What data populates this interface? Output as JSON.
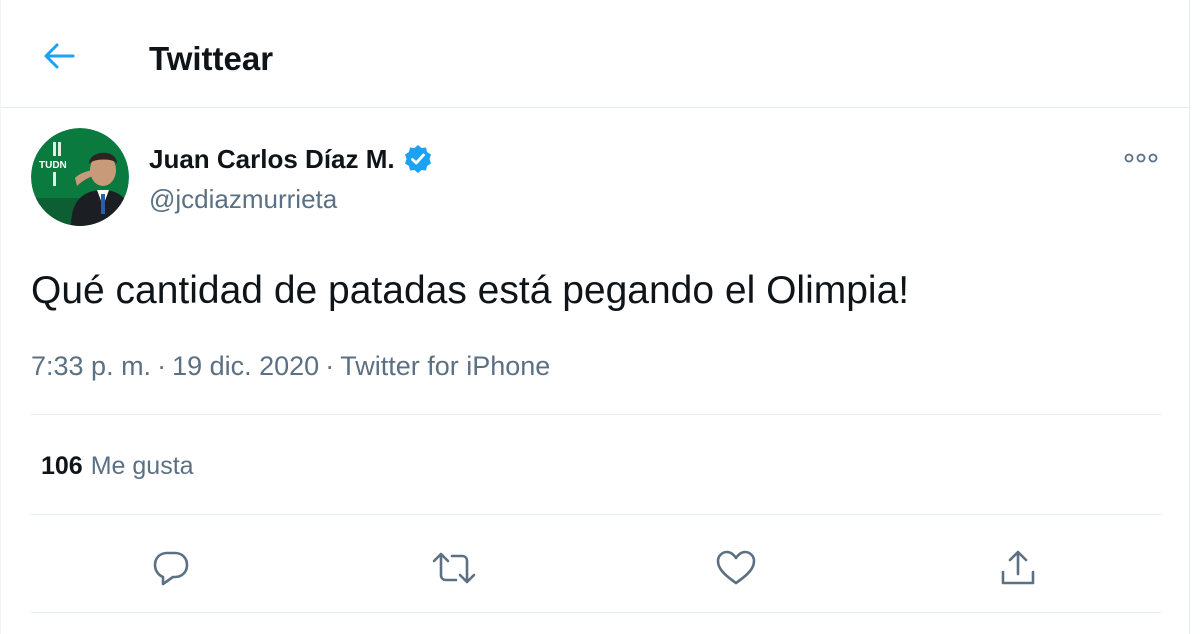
{
  "header": {
    "title": "Twittear",
    "back_icon": "arrow-left-icon"
  },
  "tweet": {
    "author": {
      "display_name": "Juan Carlos Díaz M.",
      "handle": "@jcdiazmurrieta",
      "verified": true,
      "avatar_text": "TUDN"
    },
    "text": "Qué cantidad de patadas está pegando el Olimpia!",
    "time": "7:33 p. m.",
    "separator": "·",
    "date": "19 dic. 2020",
    "source": "Twitter for iPhone",
    "likes": {
      "count": "106",
      "label": "Me gusta"
    }
  },
  "actions": [
    {
      "name": "reply",
      "icon": "reply-icon"
    },
    {
      "name": "retweet",
      "icon": "retweet-icon"
    },
    {
      "name": "like",
      "icon": "heart-icon"
    },
    {
      "name": "share",
      "icon": "share-icon"
    }
  ],
  "colors": {
    "accent": "#1da1f2",
    "text": "#0f1419",
    "muted": "#5b7083",
    "border": "#e6ecf0",
    "avatar_bg": "#0a7a3f"
  }
}
